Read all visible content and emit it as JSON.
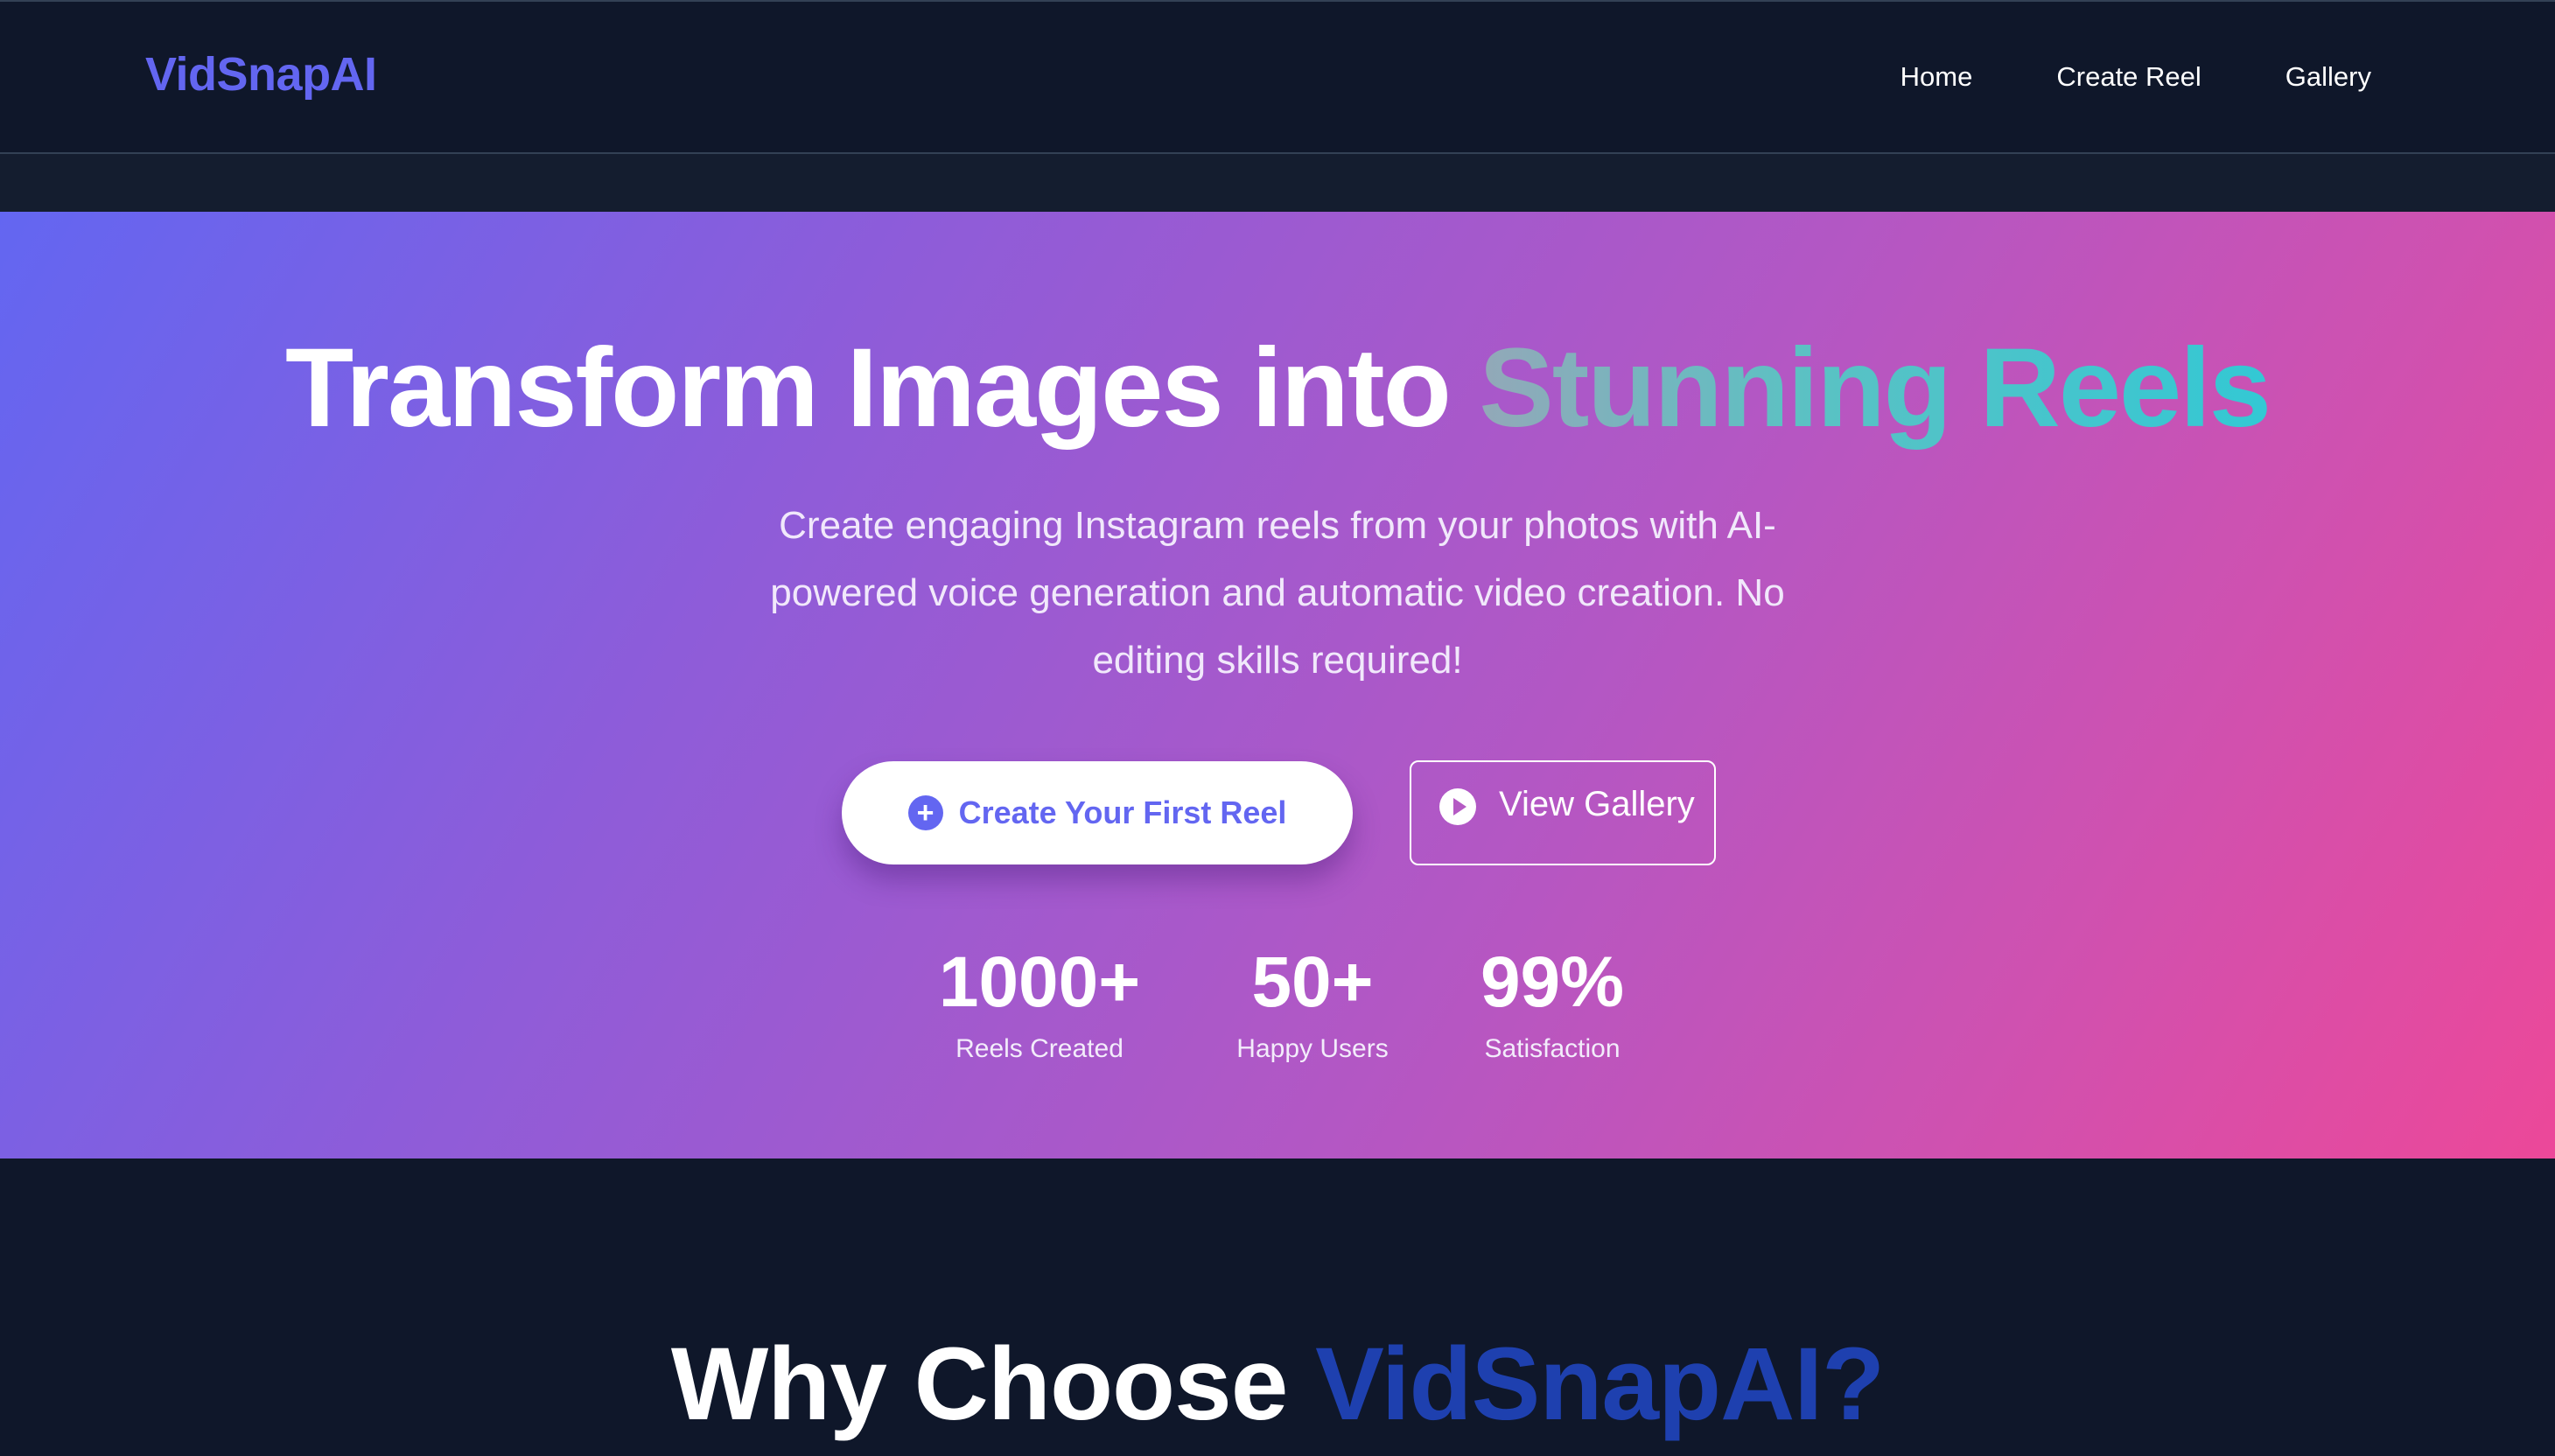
{
  "nav": {
    "logo": "VidSnapAI",
    "links": [
      "Home",
      "Create Reel",
      "Gallery"
    ]
  },
  "hero": {
    "title_main": "Transform Images into ",
    "title_accent": "Stunning Reels",
    "subtitle": "Create engaging Instagram reels from your photos with AI-powered voice generation and automatic video creation. No editing skills required!",
    "primary_button": {
      "label": "Create Your First Reel",
      "icon": "plus-circle-icon"
    },
    "secondary_button": {
      "label": "View Gallery",
      "icon": "play-circle-icon"
    },
    "stats": [
      {
        "value": "1000+",
        "label": "Reels Created"
      },
      {
        "value": "50+",
        "label": "Happy Users"
      },
      {
        "value": "99%",
        "label": "Satisfaction"
      }
    ]
  },
  "why": {
    "title_main": "Why Choose ",
    "title_accent": "VidSnapAI?"
  },
  "colors": {
    "brand": "#6366f1",
    "background": "#0f172a",
    "gradient_start": "#6366f1",
    "gradient_end": "#ec4899",
    "accent_dark_blue": "#1e40af"
  }
}
